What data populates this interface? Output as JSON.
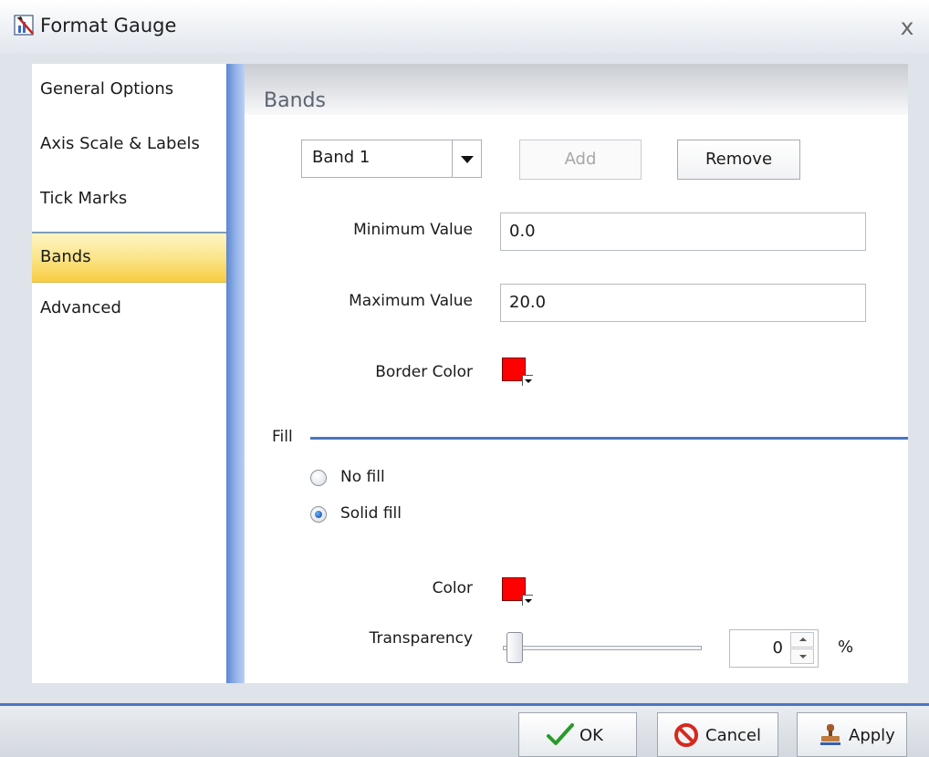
{
  "window": {
    "title": "Format Gauge",
    "app_icon": "format-gauge-icon",
    "close_icon": "close-icon",
    "close_glyph": "x"
  },
  "nav": {
    "items": [
      {
        "label": "General Options",
        "selected": false
      },
      {
        "label": "Axis Scale & Labels",
        "selected": false
      },
      {
        "label": "Tick Marks",
        "selected": false
      },
      {
        "label": "Bands",
        "selected": true
      },
      {
        "label": "Advanced",
        "selected": false
      }
    ]
  },
  "section": {
    "title": "Bands"
  },
  "bands": {
    "selected_band": "Band 1",
    "add_label": "Add",
    "add_enabled": false,
    "remove_label": "Remove",
    "min_label": "Minimum Value",
    "min_value": "0.0",
    "max_label": "Maximum Value",
    "max_value": "20.0",
    "border_color_label": "Border Color",
    "border_color": "#ff0000"
  },
  "fill": {
    "label": "Fill",
    "options": [
      {
        "label": "No fill",
        "checked": false
      },
      {
        "label": "Solid fill",
        "checked": true
      }
    ],
    "color_label": "Color",
    "color": "#ff0000",
    "transparency_label": "Transparency",
    "transparency_value": "0",
    "transparency_unit": "%"
  },
  "footer": {
    "ok_label": "OK",
    "cancel_label": "Cancel",
    "apply_label": "Apply",
    "ok_icon": "checkmark-icon",
    "cancel_icon": "cancel-icon",
    "apply_icon": "stamp-icon"
  },
  "colors": {
    "accent_line": "#4a76c2",
    "selected_nav": "#fbe58d"
  }
}
